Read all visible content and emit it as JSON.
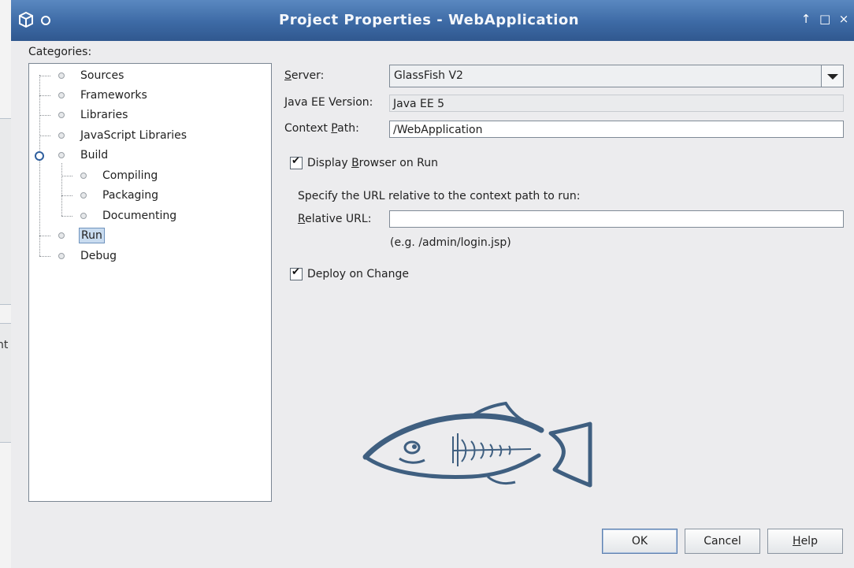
{
  "background": {
    "partial_text": "nt"
  },
  "dialog": {
    "title": "Project Properties - WebApplication",
    "window_controls": {
      "up": "↑",
      "maximize": "□",
      "close": "×"
    },
    "categories_label": "Categories:",
    "tree": [
      {
        "label": "Sources"
      },
      {
        "label": "Frameworks"
      },
      {
        "label": "Libraries"
      },
      {
        "label": "JavaScript Libraries"
      },
      {
        "label": "Build",
        "children": [
          "Compiling",
          "Packaging",
          "Documenting"
        ]
      },
      {
        "label": "Run",
        "selected": true
      },
      {
        "label": "Debug"
      }
    ],
    "form": {
      "server_label_mnemonic": "S",
      "server_label_rest": "erver:",
      "server_value": "GlassFish V2",
      "javaee_label": "Java EE Version:",
      "javaee_value": "Java EE 5",
      "context_label_pre": "Context ",
      "context_label_mnemonic": "P",
      "context_label_rest": "ath:",
      "context_value": "/WebApplication",
      "display_browser_pre": "Display ",
      "display_browser_mnemonic": "B",
      "display_browser_rest": "rowser on Run",
      "display_browser_checked": true,
      "url_hint": "Specify the URL relative to the context path to run:",
      "relative_url_mnemonic": "R",
      "relative_url_rest": "elative URL:",
      "relative_url_value": "",
      "example": "(e.g. /admin/login.jsp)",
      "deploy_on_change": "Deploy on Change",
      "deploy_on_change_checked": true
    },
    "buttons": {
      "ok": "OK",
      "cancel": "Cancel",
      "help_mnemonic": "H",
      "help_rest": "elp"
    },
    "colors": {
      "titlebar": "#3d6aa5",
      "fish": "#3f5f80",
      "selection": "#c9dcf0"
    },
    "logo": "glassfish-logo"
  }
}
